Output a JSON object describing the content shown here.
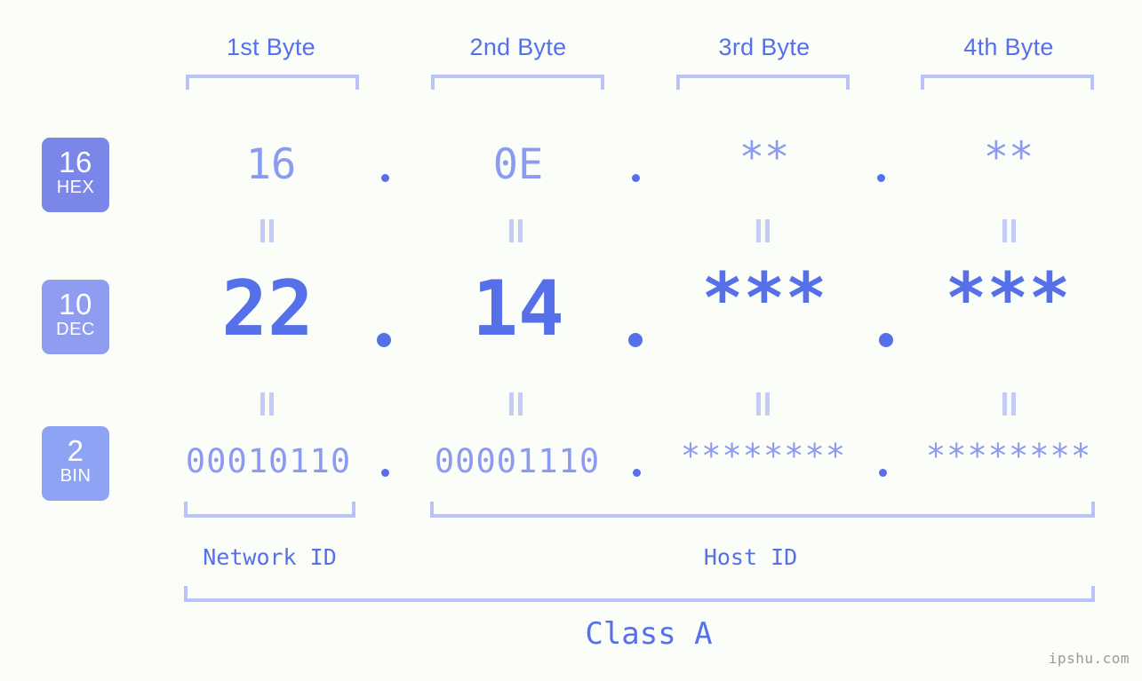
{
  "headers": [
    {
      "label": "1st Byte"
    },
    {
      "label": "2nd Byte"
    },
    {
      "label": "3rd Byte"
    },
    {
      "label": "4th Byte"
    }
  ],
  "bases": [
    {
      "number": "16",
      "name": "HEX",
      "color": "#7b87e8"
    },
    {
      "number": "10",
      "name": "DEC",
      "color": "#8f9cf0"
    },
    {
      "number": "2",
      "name": "BIN",
      "color": "#8fa3f5"
    }
  ],
  "rows": {
    "hex": {
      "values": [
        "16",
        "0E",
        "**",
        "**"
      ]
    },
    "dec": {
      "values": [
        "22",
        "14",
        "***",
        "***"
      ]
    },
    "bin": {
      "values": [
        "00010110",
        "00001110",
        "********",
        "********"
      ]
    }
  },
  "separator": ".",
  "equality_symbol": "=",
  "sections": [
    {
      "label": "Network ID"
    },
    {
      "label": "Host ID"
    }
  ],
  "class": {
    "label": "Class A"
  },
  "watermark": {
    "text": "ipshu.com"
  },
  "colors": {
    "background": "#fafdf8",
    "accent_dark": "#5570e8",
    "accent_light": "#8c9bef",
    "bracket": "#b9c3f7",
    "equality": "#c3cbf8",
    "watermark": "#9a9a9a"
  }
}
